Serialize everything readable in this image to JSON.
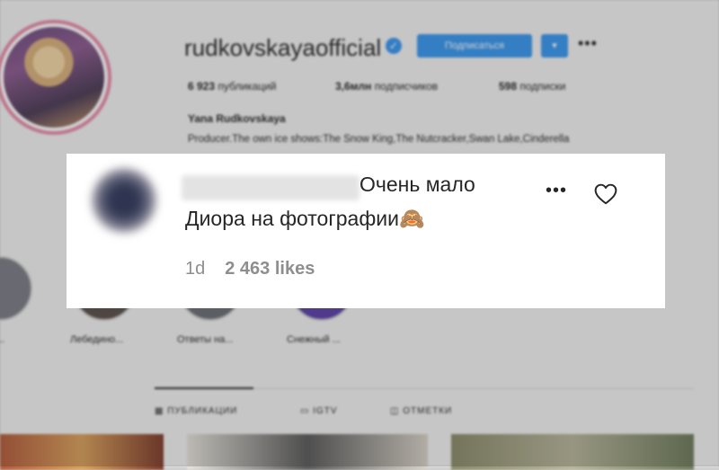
{
  "profile": {
    "username": "rudkovskayaofficial",
    "verified_glyph": "✓",
    "follow_label": "Подписаться",
    "dropdown_glyph": "▾",
    "options_glyph": "•••",
    "stats": [
      {
        "count": "6 923",
        "label": "публикаций"
      },
      {
        "count": "3,6млн",
        "label": "подписчиков"
      },
      {
        "count": "598",
        "label": "подписки"
      }
    ],
    "full_name": "Yana Rudkovskaya",
    "bio": "Producer.The own ice shows:The Snow King,The Nutcracker,Swan Lake,Cinderella"
  },
  "highlights": [
    "...",
    "Лебедино...",
    "Ответы на...",
    "Снежный ..."
  ],
  "tabs": [
    "ПУБЛИКАЦИИ",
    "IGTV",
    "ОТМЕТКИ"
  ],
  "comment": {
    "text_line1": "Очень мало",
    "text_line2": "Диора на фотографии🙈",
    "time": "1d",
    "likes": "2 463 likes",
    "more_glyph": "•••",
    "heart_icon": "heart-outline",
    "heart_color": "#262626"
  },
  "colors": {
    "accent": "#3897f0",
    "story_ring": "#e88aa8",
    "meta_text": "#8e8e8e"
  }
}
